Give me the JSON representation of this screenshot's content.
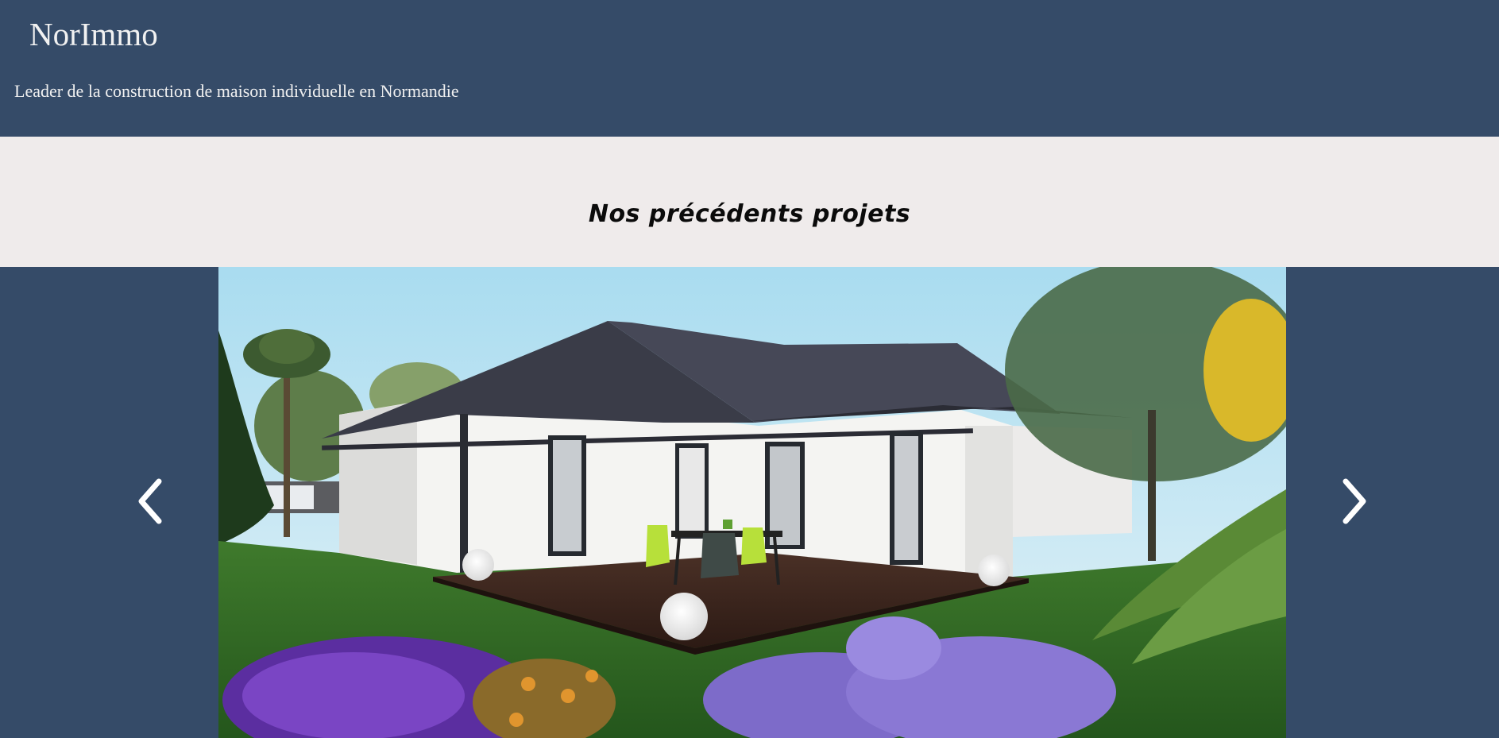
{
  "header": {
    "brand": "NorImmo",
    "tagline": "Leader de la construction de maison individuelle en Normandie"
  },
  "projects": {
    "title": "Nos précédents projets"
  },
  "carousel": {
    "prev_icon": "chevron-left-icon",
    "next_icon": "chevron-right-icon"
  },
  "colors": {
    "header_bg": "#354b68",
    "band_bg": "#efebeb",
    "header_text": "#f1f1f1",
    "title_text": "#0b0b0b"
  }
}
